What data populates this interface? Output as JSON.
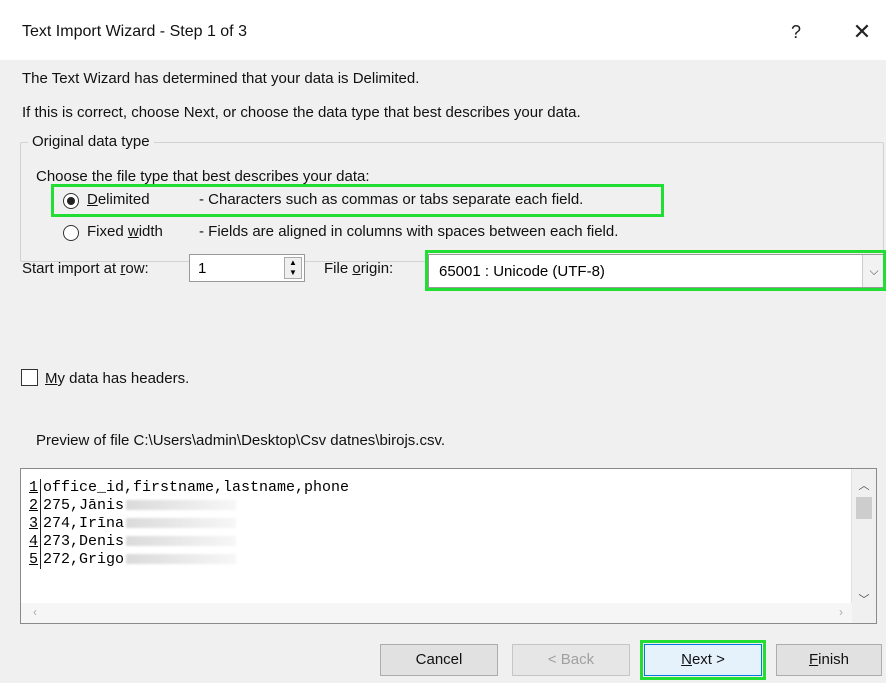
{
  "window": {
    "title": "Text Import Wizard - Step 1 of 3",
    "help_glyph": "?",
    "close_glyph": "✕"
  },
  "intro": {
    "line1": "The Text Wizard has determined that your data is Delimited.",
    "line2": "If this is correct, choose Next, or choose the data type that best describes your data."
  },
  "original_data_type": {
    "legend": "Original data type",
    "prompt": "Choose the file type that best describes your data:",
    "options": [
      {
        "label_accel": "D",
        "label_rest": "elimited",
        "description": "- Characters such as commas or tabs separate each field.",
        "selected": true
      },
      {
        "label_pre": "Fixed ",
        "label_accel": "w",
        "label_rest": "idth",
        "description": "- Fields are aligned in columns with spaces between each field.",
        "selected": false
      }
    ]
  },
  "start_row": {
    "label_pre": "Start import at ",
    "label_accel": "r",
    "label_rest": "ow:",
    "value": "1"
  },
  "file_origin": {
    "label_pre": "File ",
    "label_accel": "o",
    "label_rest": "rigin:",
    "value": "65001 : Unicode (UTF-8)"
  },
  "headers_checkbox": {
    "label_accel": "M",
    "label_rest": "y data has headers.",
    "checked": false
  },
  "preview": {
    "caption": "Preview of file C:\\Users\\admin\\Desktop\\Csv datnes\\birojs.csv.",
    "rows": [
      {
        "num": "1",
        "text": "office_id,firstname,lastname,phone"
      },
      {
        "num": "2",
        "text": "275,Jānis"
      },
      {
        "num": "3",
        "text": "274,Irīna"
      },
      {
        "num": "4",
        "text": "273,Denis"
      },
      {
        "num": "5",
        "text": "272,Grigo"
      }
    ]
  },
  "buttons": {
    "cancel": "Cancel",
    "back": "< Back",
    "next_accel": "N",
    "next_rest": "ext >",
    "finish_accel": "F",
    "finish_rest": "inish"
  },
  "colors": {
    "highlight": "#22dd33",
    "dialog_bg": "#f0f0f0"
  }
}
